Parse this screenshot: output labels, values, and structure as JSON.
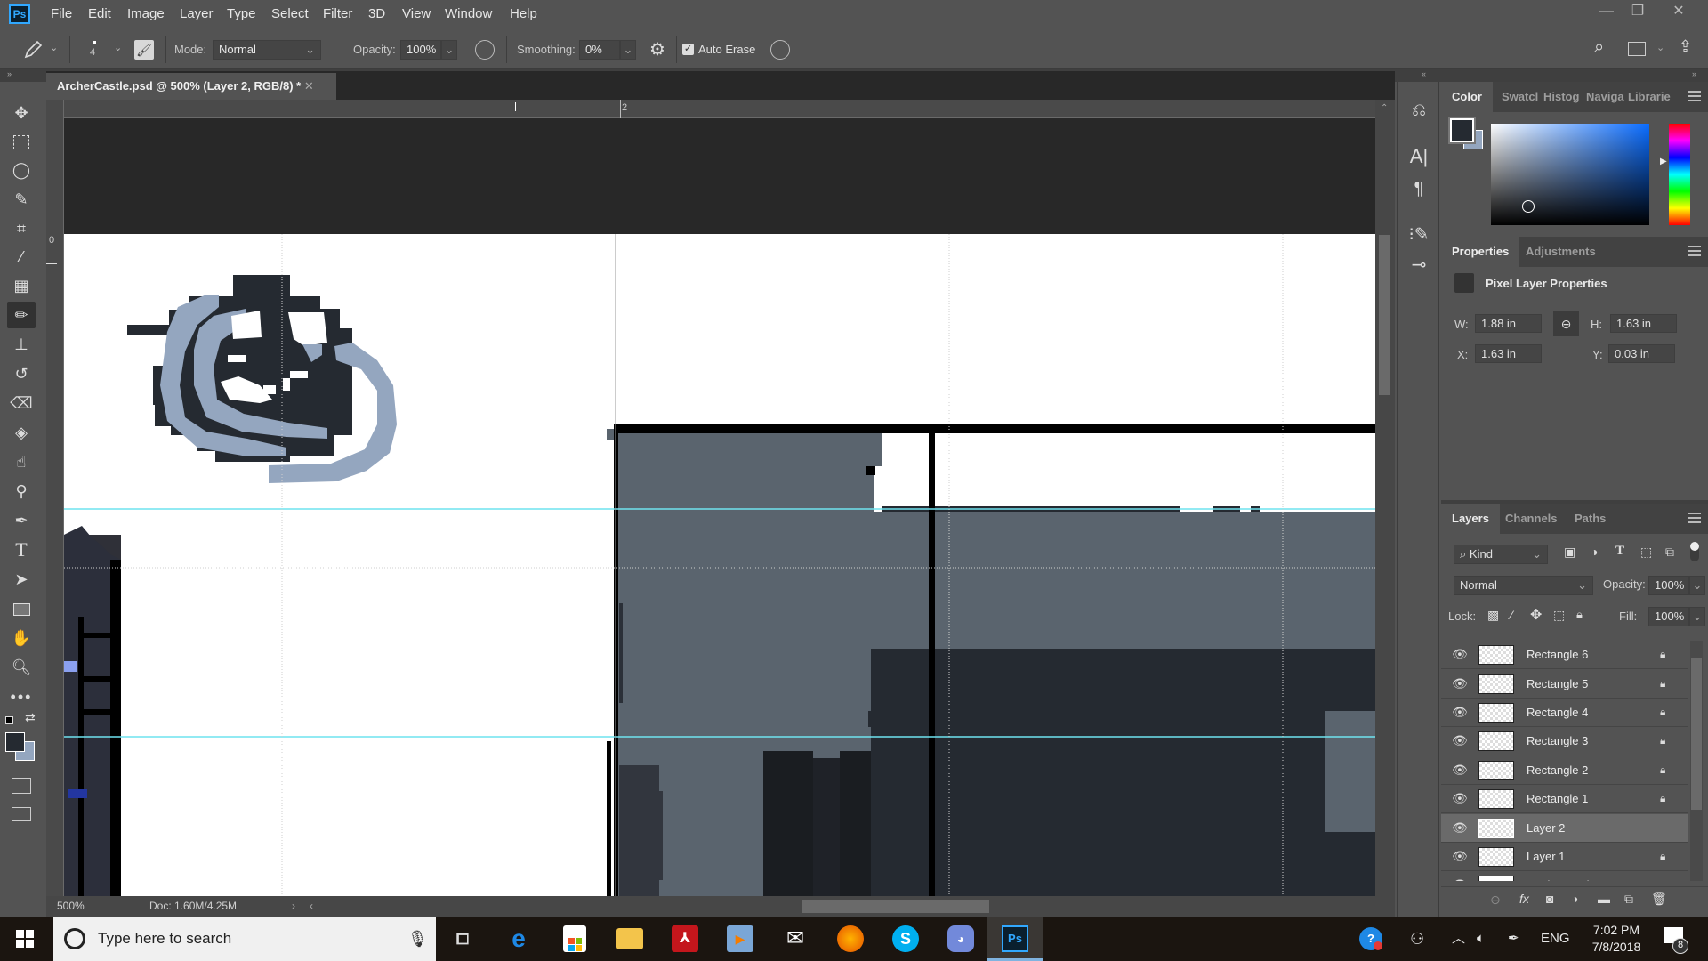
{
  "app": {
    "logo": "Ps",
    "menu": [
      "File",
      "Edit",
      "Image",
      "Layer",
      "Type",
      "Select",
      "Filter",
      "3D",
      "View",
      "Window",
      "Help"
    ],
    "window_controls": {
      "minimize": "—",
      "restore": "❐",
      "close": "✕"
    }
  },
  "options": {
    "brush_size": "4",
    "mode_label": "Mode:",
    "mode_value": "Normal",
    "opacity_label": "Opacity:",
    "opacity_value": "100%",
    "smoothing_label": "Smoothing:",
    "smoothing_value": "0%",
    "auto_erase_label": "Auto Erase",
    "auto_erase_checked": true
  },
  "document": {
    "tab_title": "ArcherCastle.psd @ 500% (Layer 2, RGB/8) *",
    "close": "✕",
    "ruler_h_label": "2",
    "ruler_v_label": "0",
    "zoom": "500%",
    "doc_size": "Doc: 1.60M/4.25M",
    "colors": {
      "dark": "#252a31",
      "light_blue": "#94a6bf",
      "slate": "#5a646e",
      "guide": "#6fe3ef"
    }
  },
  "toolbar": {
    "tools": [
      "move",
      "marquee",
      "lasso",
      "quick-selection",
      "crop",
      "eyedropper",
      "healing-brush",
      "pencil",
      "clone-stamp",
      "history-brush",
      "eraser",
      "paint-bucket",
      "smudge",
      "dodge",
      "pen",
      "type",
      "path-selection",
      "rectangle",
      "rotate-view",
      "zoom",
      "more"
    ],
    "active_tool": "pencil",
    "foreground_color": "#252a31",
    "background_color": "#94a6bf"
  },
  "color_panel": {
    "tabs": [
      "Color",
      "Swatcl",
      "Histog",
      "Naviga",
      "Librarie"
    ],
    "active_tab": "Color",
    "foreground": "#252a31",
    "background": "#94a6bf",
    "hue_base": "#0a6cff"
  },
  "properties_panel": {
    "tabs": [
      "Properties",
      "Adjustments"
    ],
    "title": "Pixel Layer Properties",
    "w_label": "W:",
    "w_value": "1.88 in",
    "h_label": "H:",
    "h_value": "1.63 in",
    "x_label": "X:",
    "x_value": "1.63 in",
    "y_label": "Y:",
    "y_value": "0.03 in"
  },
  "layers_panel": {
    "tabs": [
      "Layers",
      "Channels",
      "Paths"
    ],
    "filter_kind": "Kind",
    "blend_mode": "Normal",
    "opacity_label": "Opacity:",
    "opacity_value": "100%",
    "lock_label": "Lock:",
    "fill_label": "Fill:",
    "fill_value": "100%",
    "layers": [
      {
        "name": "Rectangle 6",
        "locked": true,
        "selected": false
      },
      {
        "name": "Rectangle 5",
        "locked": true,
        "selected": false
      },
      {
        "name": "Rectangle 4",
        "locked": true,
        "selected": false
      },
      {
        "name": "Rectangle 3",
        "locked": true,
        "selected": false
      },
      {
        "name": "Rectangle 2",
        "locked": true,
        "selected": false
      },
      {
        "name": "Rectangle 1",
        "locked": true,
        "selected": false
      },
      {
        "name": "Layer 2",
        "locked": false,
        "selected": true
      },
      {
        "name": "Layer 1",
        "locked": true,
        "selected": false
      },
      {
        "name": "Background",
        "locked": true,
        "selected": false
      }
    ]
  },
  "taskbar": {
    "search_placeholder": "Type here to search",
    "apps": [
      "task-view",
      "edge",
      "store",
      "file-explorer",
      "acrobat",
      "media-player",
      "mail",
      "firefox",
      "skype",
      "discord",
      "photoshop"
    ],
    "active_app": "photoshop",
    "language": "ENG",
    "time": "7:02 PM",
    "date": "7/8/2018",
    "notifications": "8"
  }
}
